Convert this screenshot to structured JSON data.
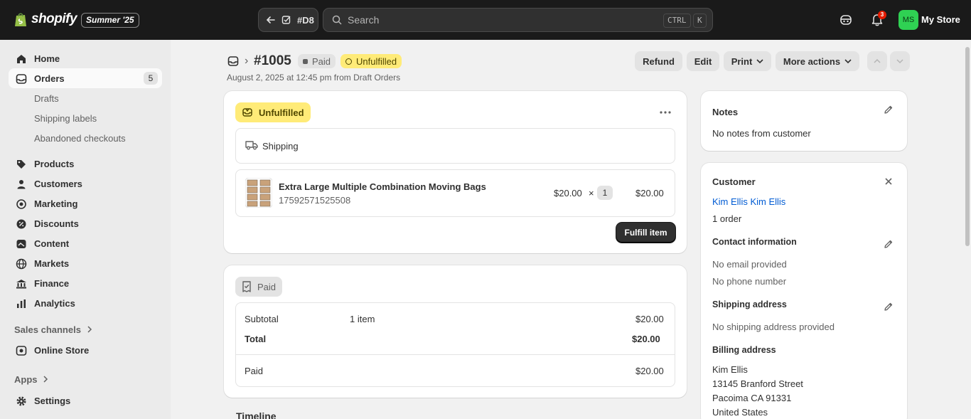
{
  "topbar": {
    "brand": "shopify",
    "edition": "Summer '25",
    "back_label": "#D8",
    "search_placeholder": "Search",
    "shortcut_ctrl": "CTRL",
    "shortcut_k": "K",
    "notification_count": "3",
    "avatar_initials": "MS",
    "store_name": "My Store",
    "colors": {
      "bg": "#1a1a1a",
      "avatar": "#2fd153"
    }
  },
  "sidebar": {
    "items": [
      {
        "label": "Home",
        "icon": "home-icon"
      },
      {
        "label": "Orders",
        "icon": "orders-icon",
        "count": "5"
      },
      {
        "label": "Products",
        "icon": "tag-icon"
      },
      {
        "label": "Customers",
        "icon": "person-icon"
      },
      {
        "label": "Marketing",
        "icon": "target-icon"
      },
      {
        "label": "Discounts",
        "icon": "discount-icon"
      },
      {
        "label": "Content",
        "icon": "content-icon"
      },
      {
        "label": "Markets",
        "icon": "globe-icon"
      },
      {
        "label": "Finance",
        "icon": "bank-icon"
      },
      {
        "label": "Analytics",
        "icon": "bar-chart-icon"
      },
      {
        "label": "Online Store",
        "icon": "store-icon"
      },
      {
        "label": "Settings",
        "icon": "gear-icon"
      }
    ],
    "order_subitems": [
      "Drafts",
      "Shipping labels",
      "Abandoned checkouts"
    ],
    "sales_channels": "Sales channels",
    "apps": "Apps"
  },
  "header": {
    "order_number": "#1005",
    "paid_badge": "Paid",
    "unfulfilled_badge": "Unfulfilled",
    "subline": "August 2, 2025 at 12:45 pm from Draft Orders",
    "actions": {
      "refund": "Refund",
      "edit": "Edit",
      "print": "Print",
      "more": "More actions"
    }
  },
  "fulfillment": {
    "status": "Unfulfilled",
    "delivery_method": "Shipping",
    "item": {
      "title": "Extra Large Multiple Combination Moving Bags",
      "sku": "17592571525508",
      "unit_price": "$20.00",
      "times": "×",
      "quantity": "1",
      "total": "$20.00"
    },
    "fulfill_button": "Fulfill item"
  },
  "payment": {
    "status": "Paid",
    "subtotal_label": "Subtotal",
    "subtotal_items": "1 item",
    "subtotal_value": "$20.00",
    "total_label": "Total",
    "total_value": "$20.00",
    "paid_label": "Paid",
    "paid_value": "$20.00"
  },
  "timeline_title": "Timeline",
  "notes": {
    "title": "Notes",
    "text": "No notes from customer"
  },
  "customer": {
    "title": "Customer",
    "name": "Kim Ellis Kim Ellis",
    "orders": "1 order",
    "contact_title": "Contact information",
    "email": "No email provided",
    "phone": "No phone number",
    "shipping_title": "Shipping address",
    "shipping_text": "No shipping address provided",
    "billing_title": "Billing address",
    "billing_lines": [
      "Kim Ellis",
      "13145 Branford Street",
      "Pacoima CA 91331",
      "United States"
    ]
  }
}
